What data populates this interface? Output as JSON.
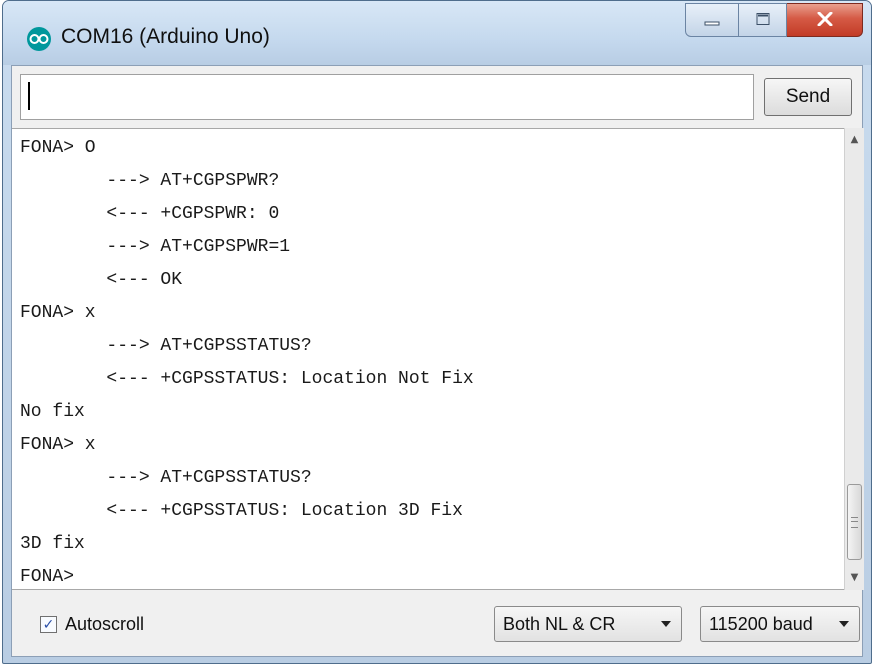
{
  "window": {
    "title": "COM16 (Arduino Uno)",
    "icon": "arduino-icon",
    "controls": [
      "minimize-icon",
      "maximize-icon",
      "close-icon"
    ]
  },
  "command_bar": {
    "input_value": "",
    "send_label": "Send"
  },
  "serial_output": {
    "lines": [
      "FONA> O",
      "        ---> AT+CGPSPWR?",
      "        <--- +CGPSPWR: 0",
      "        ---> AT+CGPSPWR=1",
      "        <--- OK",
      "FONA> x",
      "        ---> AT+CGPSSTATUS?",
      "        <--- +CGPSSTATUS: Location Not Fix",
      "No fix",
      "FONA> x",
      "        ---> AT+CGPSSTATUS?",
      "        <--- +CGPSSTATUS: Location 3D Fix",
      "3D fix",
      "FONA>"
    ]
  },
  "footer": {
    "autoscroll_label": "Autoscroll",
    "autoscroll_checked": true,
    "line_ending_value": "Both NL & CR",
    "baud_value": "115200 baud"
  },
  "colors": {
    "title_bar": "#c5d9ee",
    "close_button": "#c23b26",
    "arduino_teal": "#00979c"
  }
}
